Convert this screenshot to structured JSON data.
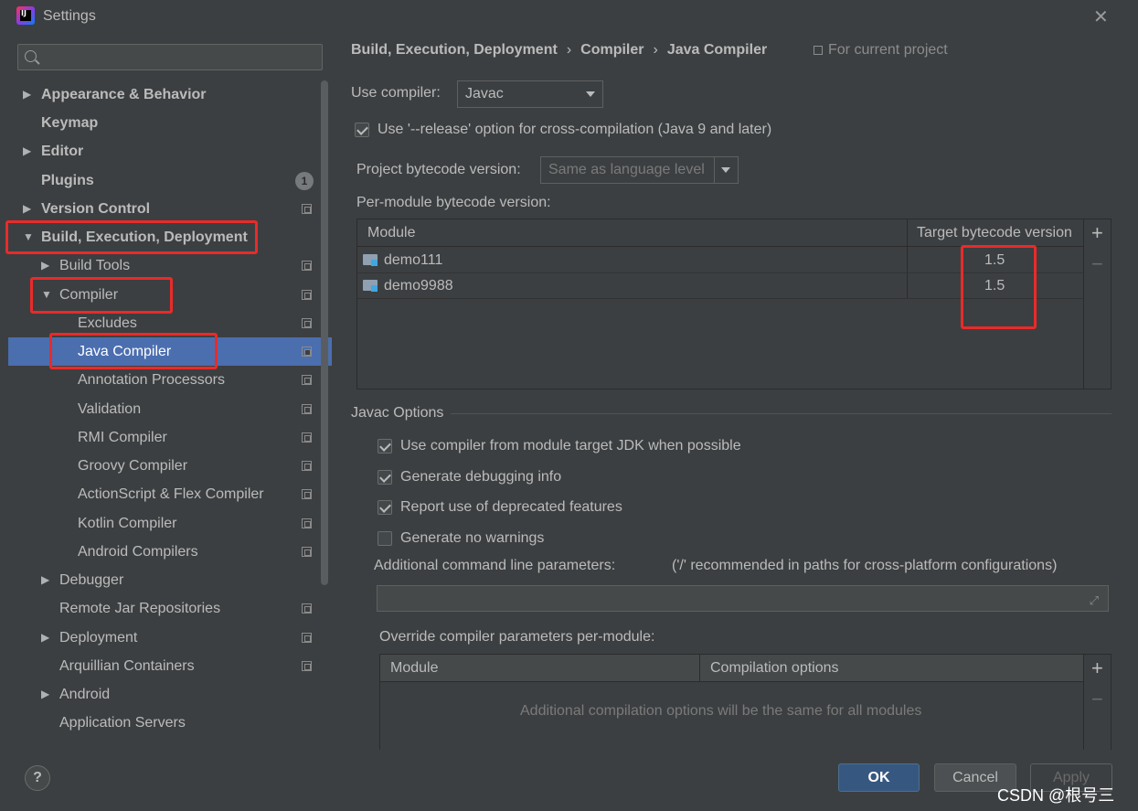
{
  "window": {
    "title": "Settings"
  },
  "search": {
    "placeholder": ""
  },
  "tree": [
    {
      "label": "Appearance & Behavior"
    },
    {
      "label": "Keymap"
    },
    {
      "label": "Editor"
    },
    {
      "label": "Plugins",
      "badge": "1"
    },
    {
      "label": "Version Control"
    },
    {
      "label": "Build, Execution, Deployment"
    },
    {
      "label": "Build Tools"
    },
    {
      "label": "Compiler"
    },
    {
      "label": "Excludes"
    },
    {
      "label": "Java Compiler"
    },
    {
      "label": "Annotation Processors"
    },
    {
      "label": "Validation"
    },
    {
      "label": "RMI Compiler"
    },
    {
      "label": "Groovy Compiler"
    },
    {
      "label": "ActionScript & Flex Compiler"
    },
    {
      "label": "Kotlin Compiler"
    },
    {
      "label": "Android Compilers"
    },
    {
      "label": "Debugger"
    },
    {
      "label": "Remote Jar Repositories"
    },
    {
      "label": "Deployment"
    },
    {
      "label": "Arquillian Containers"
    },
    {
      "label": "Android"
    },
    {
      "label": "Application Servers"
    }
  ],
  "breadcrumb": {
    "part1": "Build, Execution, Deployment",
    "part2": "Compiler",
    "part3": "Java Compiler",
    "sep": "›",
    "for_project": "For current project"
  },
  "use_compiler": {
    "label": "Use compiler:",
    "value": "Javac"
  },
  "release_option": {
    "label": "Use '--release' option for cross-compilation (Java 9 and later)",
    "checked": true
  },
  "project_bytecode": {
    "label": "Project bytecode version:",
    "value": "Same as language level"
  },
  "per_module": {
    "label": "Per-module bytecode version:",
    "headers": [
      "Module",
      "Target bytecode version"
    ],
    "rows": [
      {
        "module": "demo111",
        "version": "1.5"
      },
      {
        "module": "demo9988",
        "version": "1.5"
      }
    ]
  },
  "javac": {
    "title": "Javac Options",
    "options": [
      {
        "label": "Use compiler from module target JDK when possible",
        "checked": true
      },
      {
        "label": "Generate debugging info",
        "checked": true
      },
      {
        "label": "Report use of deprecated features",
        "checked": true
      },
      {
        "label": "Generate no warnings",
        "checked": false
      }
    ],
    "additional_label": "Additional command line parameters:",
    "additional_hint": "('/' recommended in paths for cross-platform configurations)",
    "override_label": "Override compiler parameters per-module:",
    "override_headers": [
      "Module",
      "Compilation options"
    ],
    "override_empty": "Additional compilation options will be the same for all modules"
  },
  "buttons": {
    "help": "?",
    "ok": "OK",
    "cancel": "Cancel",
    "apply": "Apply"
  },
  "watermark": "CSDN @根号三"
}
